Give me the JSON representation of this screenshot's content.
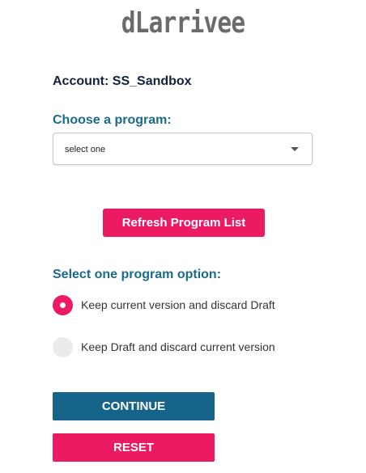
{
  "header": {
    "logo_text": "dLarrivee"
  },
  "account": {
    "label": "Account: SS_Sandbox"
  },
  "program_select": {
    "label": "Choose a program:",
    "selected_value": "select one",
    "caret_icon": "caret-down-icon"
  },
  "refresh_button": {
    "label": "Refresh Program List"
  },
  "program_options": {
    "heading": "Select one program option:",
    "items": [
      {
        "label": "Keep current version and discard Draft",
        "checked": true
      },
      {
        "label": "Keep Draft and discard current version",
        "checked": false
      }
    ]
  },
  "actions": {
    "continue_label": "CONTINUE",
    "reset_label": "RESET"
  },
  "colors": {
    "accent_pink": "#eb1a63",
    "heading_teal": "#1a6a8c",
    "primary_button": "#17648a",
    "dark_text": "#14213d",
    "logo_gray": "#6b6b6b"
  }
}
